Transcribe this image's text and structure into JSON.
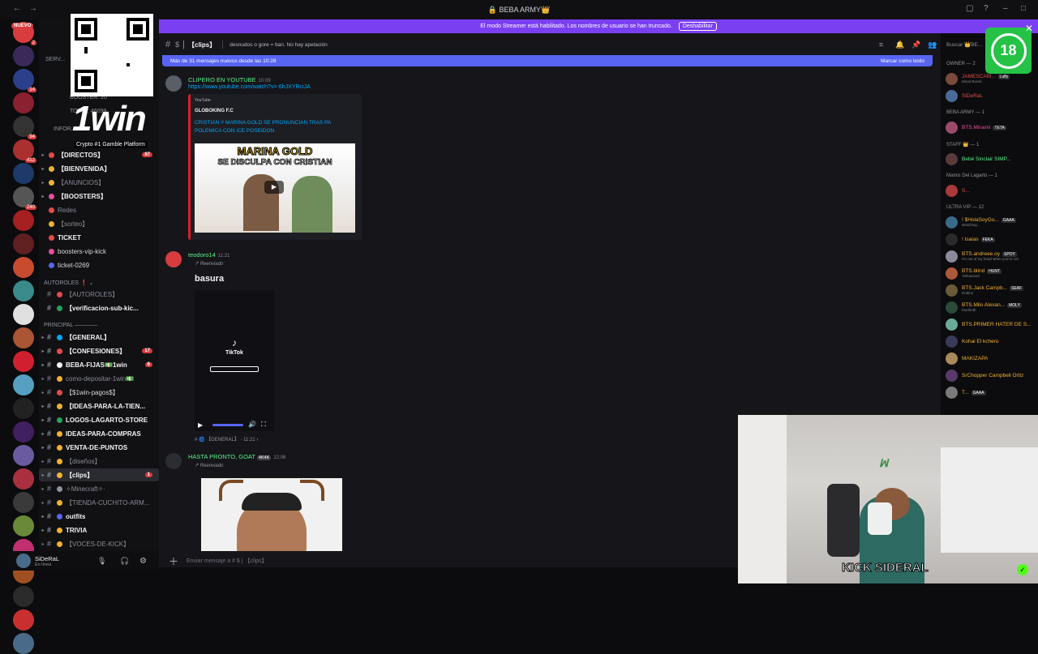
{
  "window": {
    "title": "🔒 BEBA ARMY👑"
  },
  "streamer_banner": {
    "text": "El modo Streamer está habilitado. Los nombres de usuario se han truncado.",
    "button": "Deshabilitar"
  },
  "overlay": {
    "brand": "1win",
    "tagline": "Crypto #1 Gamble Platform",
    "age": "18",
    "kick_label": "KICK SIDERAL"
  },
  "server_rail": {
    "nuevo_label": "NUEVO",
    "badges": [
      "2",
      "",
      "14",
      "",
      "94",
      "412",
      "",
      "240",
      "",
      "",
      "",
      "",
      "",
      "",
      "",
      "",
      "",
      "",
      "",
      "",
      "",
      "",
      "",
      "",
      "",
      "",
      ""
    ]
  },
  "sidebar": {
    "boosters_label": "BOOSTER: 20",
    "total_label": "TOTAL: 46099",
    "servers_label": "SERV...",
    "info_label": "INFOR...",
    "items": [
      {
        "label": "【DIRECTOS】",
        "mention": "87"
      },
      {
        "label": "【BIENVENIDA】"
      },
      {
        "label": "【ANUNCIOS】"
      },
      {
        "label": "【BOOSTERS】"
      },
      {
        "label": "Redes"
      },
      {
        "label": "【sorteo】"
      },
      {
        "label": "TICKET"
      },
      {
        "label": "boosters-vip-kick"
      },
      {
        "label": "ticket-0269"
      }
    ],
    "cat_autoroles": "AUTOROLES ❗ ⌄",
    "autoroles": [
      {
        "label": "【AUTOROLES】"
      },
      {
        "label": "【verificacion-sub-kic..."
      }
    ],
    "cat_principal": "PRINCIPAL ————",
    "principal": [
      {
        "label": "【GENERAL】"
      },
      {
        "label": "【CONFESIONES】",
        "mention": "17"
      },
      {
        "label": "BEBA-FIJAS💵1win",
        "mention": "6"
      },
      {
        "label": "como-depositar-1win💵"
      },
      {
        "label": "【$1win-pagos$】"
      },
      {
        "label": "【IDEAS-PARA-LA-TIEN..."
      },
      {
        "label": "LOGOS-LAGARTO-STORE"
      },
      {
        "label": "IDEAS-PARA-COMPRAS"
      },
      {
        "label": "VENTA-DE-PUNTOS"
      },
      {
        "label": "【diseños】"
      },
      {
        "label": "【clips】",
        "mention": "1"
      },
      {
        "label": "✧Minecraft✧·"
      },
      {
        "label": "【TIENDA-CUCHITO-ARM..."
      },
      {
        "label": "outfits"
      },
      {
        "label": "TRIVIA"
      },
      {
        "label": "【VOCES-DE-KICK】"
      }
    ]
  },
  "user": {
    "name": "SiDeRaL",
    "status": "En línea"
  },
  "channel": {
    "name": "【clips】",
    "topic": "desnudos o gore = ban. No hay apelación",
    "search_placeholder": "Buscar 👑BE..."
  },
  "new_messages": {
    "text": "Más de 31 mensajes nuevos desde las 10:28",
    "mark_read": "Marcar como leído"
  },
  "messages": [
    {
      "author": "CLIPERO EN YOUTUBE",
      "time": "10:09",
      "link": "https://www.youtube.com/watch?v=-6hJXYRciJA",
      "embed_provider": "YouTube",
      "embed_author": "GLOBOKING F.C",
      "embed_title": "CRISTIAN Y MARINA GOLD SE PRONUNCIAN TRAS PA POLEMICA CON ICE POSEIDON",
      "thumb_line1": "MARINA GOLD",
      "thumb_line2": "SE DISCULPA CON CRISTIAN"
    },
    {
      "author": "teodoro14",
      "time": "11:21",
      "forwarded": "Reenviado",
      "text": "basura",
      "video_label": "TikTok",
      "source": "# 🌀 【GENERAL】 · 11:21 ›"
    },
    {
      "author": "HASTA PRONTO, GOAT",
      "tag": "4K4K",
      "time": "12:06",
      "forwarded": "Reenviado"
    }
  ],
  "composer": {
    "placeholder": "Enviar mensaje a # $ | 【clips】"
  },
  "members": {
    "groups": [
      {
        "header": "OWNER — 2",
        "rows": [
          {
            "name": "JAMESCAM...",
            "tag": "Luffy",
            "status": "Mood Bored",
            "color": "#e34b4b"
          },
          {
            "name": "SiDeRaL",
            "color": "#e34b4b"
          }
        ]
      },
      {
        "header": "BEBA ARMY — 1",
        "rows": [
          {
            "name": "BTS.Minami",
            "tag": "TETA",
            "color": "#eb4ea0"
          }
        ]
      },
      {
        "header": "STAFF 👑 — 1",
        "rows": [
          {
            "name": "Bebé Sinclair SIMP...",
            "color": "#57f287"
          }
        ]
      },
      {
        "header": "Mamis Del Lagarto — 1",
        "rows": [
          {
            "name": "S...",
            "color": "#e34b4b"
          }
        ]
      },
      {
        "header": "ULTRA VIP — 12",
        "rows": [
          {
            "name": "! $HolaSoyGo...",
            "tag": "GAAA",
            "status": "Watching...",
            "color": "#f0b232"
          },
          {
            "name": "! Isaias",
            "tag": "FEKA",
            "color": "#f0b232"
          },
          {
            "name": "BTS.andreee.oy",
            "tag": "SPOY",
            "status": "I'm out of my head when you're not",
            "color": "#f0b232"
          },
          {
            "name": "BTS.blind",
            "tag": "HUNT",
            "status": "Yellowcard",
            "color": "#f0b232"
          },
          {
            "name": "BTS.Jack Campb...",
            "tag": "SEAF",
            "status": "Roblox",
            "color": "#f0b232"
          },
          {
            "name": "BTS.Milo Alexan...",
            "tag": "MOLY",
            "status": "Modrinth",
            "color": "#f0b232"
          },
          {
            "name": "BTS.PRIMER HATER DE S...",
            "color": "#f0b232"
          },
          {
            "name": "Kohai El kchero",
            "color": "#f0b232"
          },
          {
            "name": "MAKIZAPA",
            "color": "#f0b232"
          },
          {
            "name": "SrChopper Campbell Ortiz",
            "color": "#f0b232"
          },
          {
            "name": "T...",
            "tag": "GAAA",
            "color": "#f0b232"
          }
        ]
      }
    ]
  },
  "colors": {
    "accent": "#5865f2",
    "streamer": "#7b3ff2",
    "link": "#00a8fc",
    "mention": "#d83c3e"
  }
}
